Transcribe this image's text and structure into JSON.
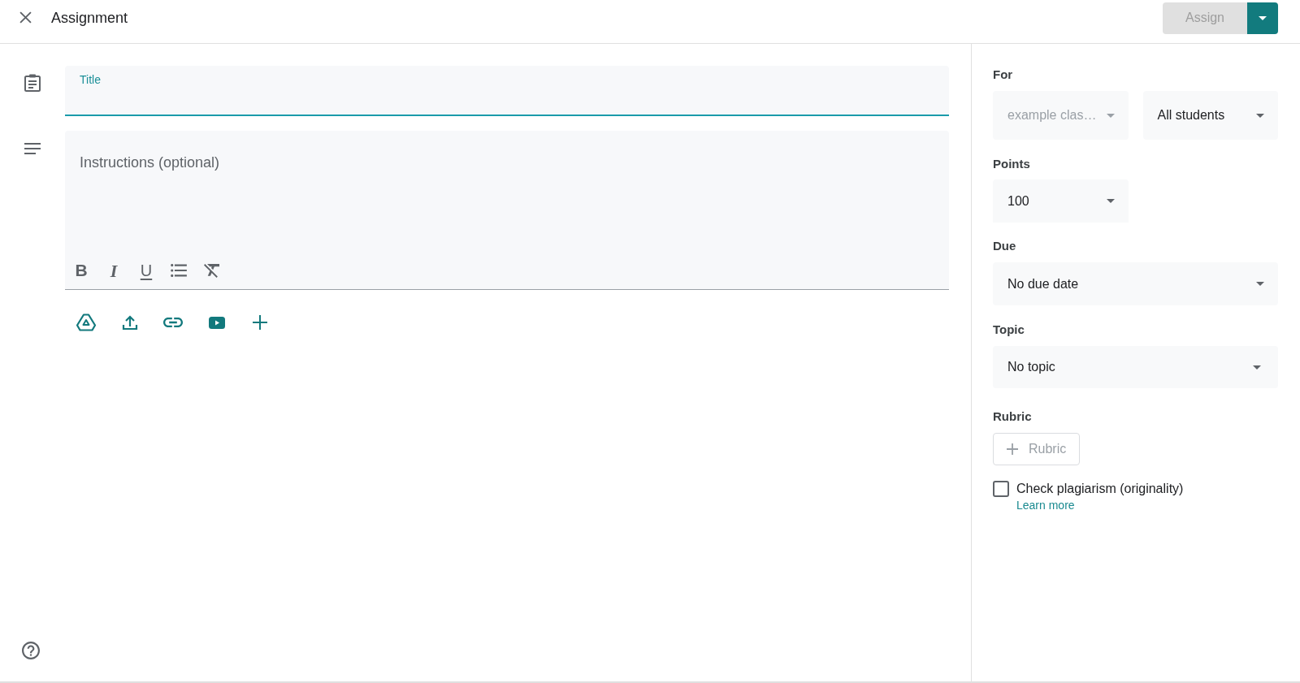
{
  "header": {
    "title": "Assignment",
    "assign_button": {
      "label": "Assign",
      "disabled": true
    }
  },
  "editor": {
    "title_field": {
      "label": "Title",
      "focused": true
    },
    "instructions_field": {
      "placeholder": "Instructions (optional)"
    },
    "format_buttons": [
      {
        "kind": "bold",
        "glyph": "B"
      },
      {
        "kind": "italic",
        "glyph": "I"
      },
      {
        "kind": "underline",
        "glyph": "U"
      },
      {
        "kind": "bulleted-list"
      },
      {
        "kind": "clear-formatting"
      }
    ]
  },
  "settings": {
    "for": {
      "label": "For",
      "class_select": {
        "value": "example clas…",
        "disabled": true
      },
      "students_select": {
        "value": "All students",
        "disabled": false
      }
    },
    "points": {
      "label": "Points",
      "value": "100"
    },
    "due": {
      "label": "Due",
      "value": "No due date"
    },
    "topic": {
      "label": "Topic",
      "value": "No topic"
    },
    "rubric": {
      "label": "Rubric",
      "button": {
        "label": "Rubric",
        "disabled": true
      }
    },
    "plagiarism": {
      "label": "Check plagiarism (originality)",
      "checked": false,
      "link": "Learn more"
    }
  }
}
